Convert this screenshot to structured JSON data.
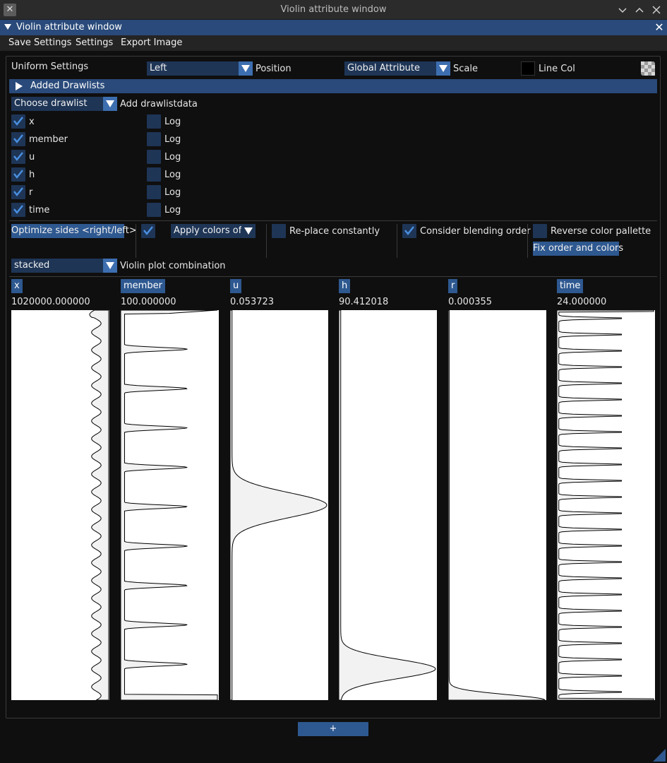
{
  "window": {
    "title": "Violin attribute window",
    "app_icon": "x-logo-icon"
  },
  "imgui_window": {
    "title": "Violin attribute window"
  },
  "menu": {
    "items": [
      "Save Settings",
      "Settings",
      "Export Image"
    ]
  },
  "uniform": {
    "label": "Uniform Settings",
    "position_value": "Left",
    "position_label": "Position",
    "scale_value": "Global Attribute",
    "scale_label": "Scale",
    "line_col_label": "Line Col",
    "line_color": "#000000"
  },
  "drawlists": {
    "header": "Added Drawlists",
    "choose_value": "Choose drawlist",
    "add_label": "Add drawlistdata"
  },
  "attributes": [
    {
      "name": "x",
      "checked": true,
      "log_label": "Log",
      "log": false
    },
    {
      "name": "member",
      "checked": true,
      "log_label": "Log",
      "log": false
    },
    {
      "name": "u",
      "checked": true,
      "log_label": "Log",
      "log": false
    },
    {
      "name": "h",
      "checked": true,
      "log_label": "Log",
      "log": false
    },
    {
      "name": "r",
      "checked": true,
      "log_label": "Log",
      "log": false
    },
    {
      "name": "time",
      "checked": true,
      "log_label": "Log",
      "log": false
    }
  ],
  "options": {
    "optimize_sides": "Optimize sides <right/left>",
    "apply_colors_checked": true,
    "apply_colors_value": "Apply colors of D",
    "replace_constantly": "Re-place constantly",
    "replace_constantly_checked": false,
    "consider_blending": "Consider blending order",
    "consider_blending_checked": true,
    "reverse_palette": "Reverse color pallette",
    "reverse_palette_checked": false,
    "fix_order": "Fix order and colors"
  },
  "combination": {
    "value": "stacked",
    "label": "Violin plot combination"
  },
  "plots": [
    {
      "name": "x",
      "max": "1020000.000000"
    },
    {
      "name": "member",
      "max": "100.000000"
    },
    {
      "name": "u",
      "max": "0.053723"
    },
    {
      "name": "h",
      "max": "90.412018"
    },
    {
      "name": "r",
      "max": "0.000355"
    },
    {
      "name": "time",
      "max": "24.000000"
    }
  ],
  "add_button": "+",
  "colors": {
    "accent": "#2e5890",
    "frame": "#1e3556",
    "title_active": "#294a7a",
    "check": "#4a90e2",
    "plot_bg": "#ffffff",
    "violin_fill": "#f2f2f2",
    "violin_line": "#000000"
  }
}
